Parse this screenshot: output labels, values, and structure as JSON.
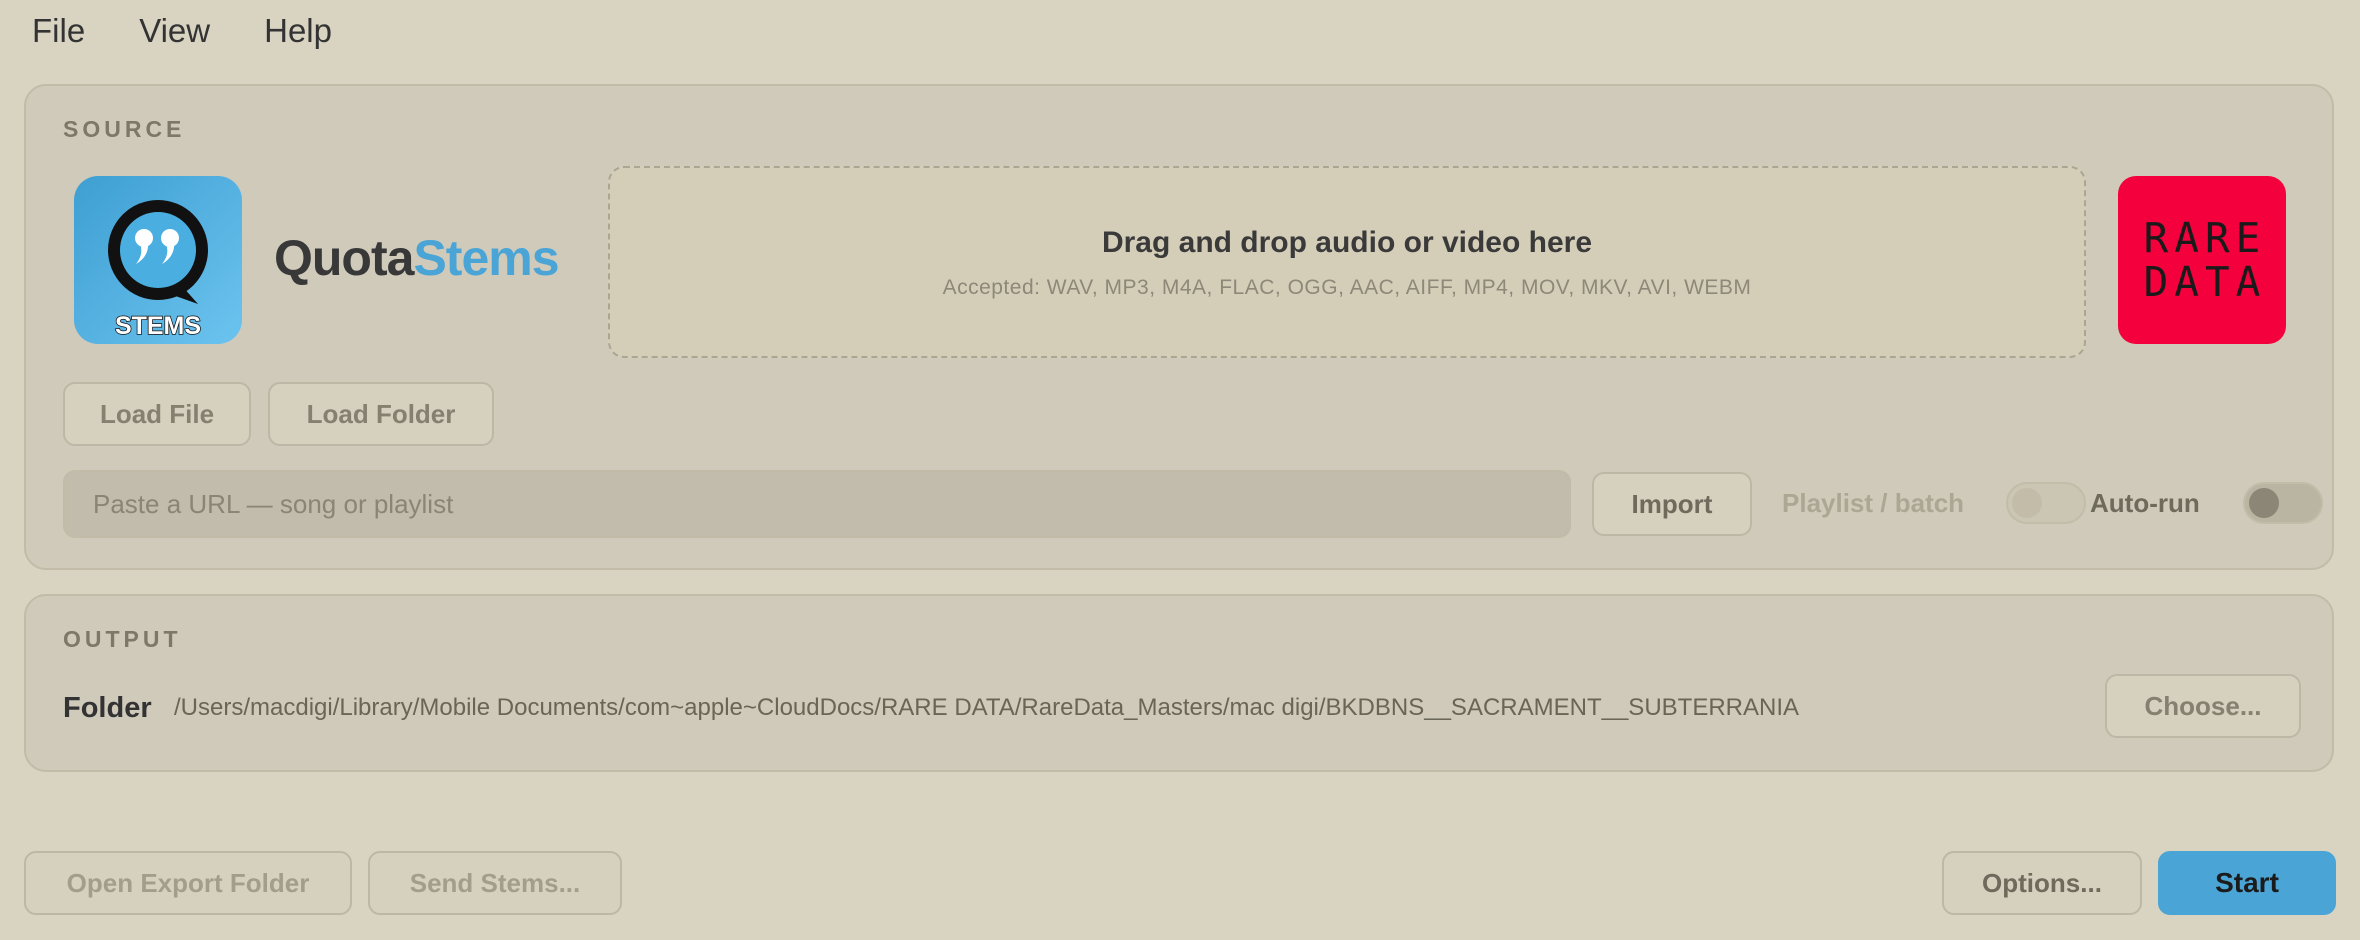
{
  "menu": {
    "items": [
      "File",
      "View",
      "Help"
    ]
  },
  "source": {
    "title": "SOURCE",
    "app_icon_label": "STEMS",
    "brand_part1": "Quota",
    "brand_part2": "Stems",
    "dropzone_title": "Drag and drop audio or video here",
    "dropzone_accepted": "Accepted: WAV, MP3, M4A, FLAC, OGG, AAC, AIFF, MP4, MOV, MKV, AVI, WEBM",
    "logo_line1": "RARE",
    "logo_line2": "DATA",
    "load_file_label": "Load File",
    "load_folder_label": "Load Folder",
    "url_placeholder": "Paste a URL — song or playlist",
    "url_value": "",
    "import_label": "Import",
    "playlist_label": "Playlist / batch",
    "playlist_enabled": false,
    "playlist_on": false,
    "autorun_label": "Auto-run",
    "autorun_on": false
  },
  "output": {
    "title": "OUTPUT",
    "folder_label": "Folder",
    "folder_path": "/Users/macdigi/Library/Mobile Documents/com~apple~CloudDocs/RARE DATA/RareData_Masters/mac digi/BKDBNS__SACRAMENT__SUBTERRANIA",
    "choose_label": "Choose..."
  },
  "bottom": {
    "open_export_label": "Open Export Folder",
    "send_stems_label": "Send Stems...",
    "options_label": "Options...",
    "start_label": "Start"
  },
  "colors": {
    "background": "#d9d3c2",
    "panel": "#d0cabb",
    "accent": "#4aa5d6",
    "logo_red": "#f4003c"
  }
}
